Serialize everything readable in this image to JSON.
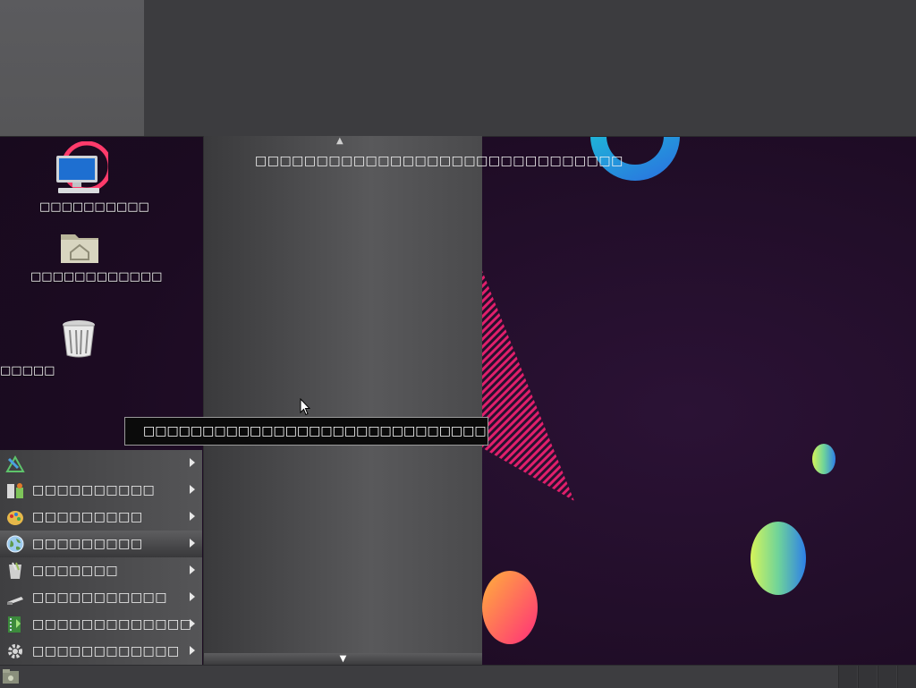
{
  "desktop": {
    "icons": [
      {
        "label": "□□□□□□□□□□",
        "icon": "computer-icon"
      },
      {
        "label": "□□□□□□□□□□□□",
        "icon": "home-folder-icon"
      },
      {
        "label": "□□□□□",
        "icon": "trash-icon"
      }
    ]
  },
  "submenu": {
    "title": "□□□□□□□□□□□□□□□□□□□□□□□□□□□□□□",
    "scroll_up": "▲",
    "scroll_down": "▼"
  },
  "tooltip": {
    "text": "□□□□□□□□□□□□□□□□□□□□□□□□□□□□□□□□□□□□□□□□□□□□□□□"
  },
  "main_menu": {
    "items": [
      {
        "label": "",
        "icon": "accessories-icon",
        "active": false
      },
      {
        "label": "□□□□□□□□□□",
        "icon": "education-icon",
        "active": false
      },
      {
        "label": "□□□□□□□□□",
        "icon": "graphics-icon",
        "active": false
      },
      {
        "label": "□□□□□□□□□",
        "icon": "internet-icon",
        "active": true
      },
      {
        "label": "□□□□□□□",
        "icon": "office-icon",
        "active": false
      },
      {
        "label": "□□□□□□□□□□□",
        "icon": "programming-icon",
        "active": false
      },
      {
        "label": "□□□□□□□□□□□□□",
        "icon": "sound-video-icon",
        "active": false
      },
      {
        "label": "□□□□□□□□□□□□",
        "icon": "system-tools-icon",
        "active": false
      }
    ]
  },
  "colors": {
    "panel": "#3c3c3f",
    "desktop_bg": "#1c0b22",
    "accent_pink": "#e0206a",
    "accent_blue": "#2a7fe0"
  }
}
